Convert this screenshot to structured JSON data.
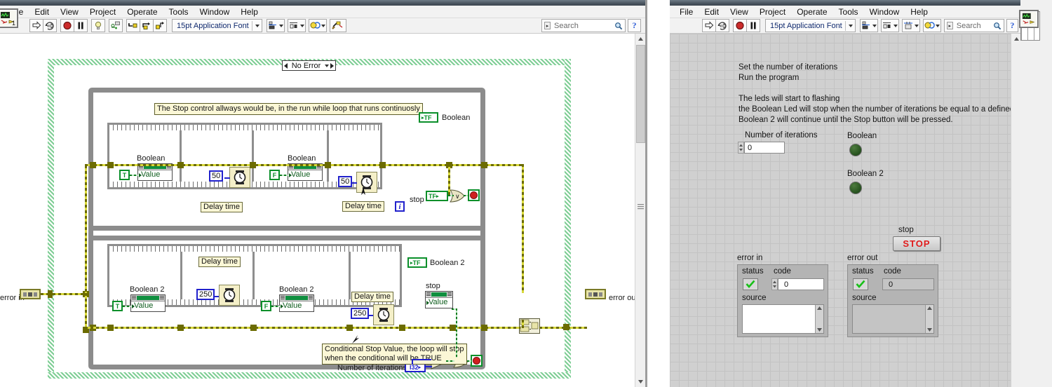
{
  "block_diagram_window": {
    "menu": [
      "File",
      "Edit",
      "View",
      "Project",
      "Operate",
      "Tools",
      "Window",
      "Help"
    ],
    "toolbar": {
      "run_icon": "run-arrow-icon",
      "run_continuously_icon": "run-continuously-icon",
      "abort_icon": "abort-execution-icon",
      "pause_icon": "pause-icon",
      "highlight_icon": "highlight-execution-bulb-icon",
      "retain_wire_icon": "retain-wire-values-icon",
      "step_into_icon": "step-into-icon",
      "step_over_icon": "step-over-icon",
      "step_out_icon": "step-out-icon",
      "font": "15pt Application Font",
      "align_icon": "align-objects-icon",
      "distribute_icon": "distribute-objects-icon",
      "reorder_icon": "reorder-objects-icon",
      "cleanup_icon": "clean-up-diagram-icon",
      "search_placeholder": "Search",
      "help_icon": "context-help-icon",
      "vi_icon_badge": "1"
    },
    "diagram": {
      "case_selector": "No Error",
      "comment_top": "The Stop control allways would be, in the run while loop that runs continuosly",
      "comment_bottom": "Conditional Stop Value, the loop will stop\nwhen the conditional will be TRUE",
      "loop1": {
        "frames": [
          {
            "bool_const": "T",
            "prop_label": "Boolean",
            "prop_row": "Value"
          },
          {
            "num_const": "50",
            "delay_label": "Delay time",
            "node": "wait-ms-icon"
          },
          {
            "bool_const": "F",
            "prop_label": "Boolean",
            "prop_row": "Value"
          },
          {
            "num_const": "50",
            "delay_label": "Delay time",
            "node": "wait-ms-icon"
          }
        ],
        "indicator_label": "Boolean",
        "indicator_text": "TF",
        "iteration_terminal": "i",
        "stop_label": "stop",
        "stop_terminal_text": "TF",
        "or_gate": "or-gate",
        "loop_stop": "loop-conditional-terminal"
      },
      "loop2": {
        "frames": [
          {
            "bool_const": "T",
            "prop_label": "Boolean 2",
            "prop_row": "Value"
          },
          {
            "num_const": "250",
            "delay_label": "Delay time",
            "node": "wait-ms-icon"
          },
          {
            "bool_const": "F",
            "prop_label": "Boolean 2",
            "prop_row": "Value"
          },
          {
            "num_const": "250",
            "delay_label": "Delay time",
            "node": "wait-ms-icon"
          }
        ],
        "indicator_label": "Boolean 2",
        "indicator_text": "TF",
        "stop_label": "stop",
        "stop_prop_row": "Value",
        "iteration_terminal": "i",
        "iterations_label": "Number of iterations",
        "iterations_type": "I32",
        "equal_gate": "=",
        "or_gate": "or-gate",
        "loop_stop": "loop-conditional-terminal"
      },
      "error_in_label": "error in",
      "error_out_label": "error out",
      "merge_errors": "merge-errors-node"
    }
  },
  "front_panel_window": {
    "menu": [
      "File",
      "Edit",
      "View",
      "Project",
      "Operate",
      "Tools",
      "Window",
      "Help"
    ],
    "toolbar": {
      "run_icon": "run-arrow-icon",
      "run_continuously_icon": "run-continuously-icon",
      "abort_icon": "abort-execution-icon",
      "pause_icon": "pause-icon",
      "font": "15pt Application Font",
      "align_icon": "align-objects-icon",
      "distribute_icon": "distribute-objects-icon",
      "resize_icon": "resize-objects-icon",
      "reorder_icon": "reorder-objects-icon",
      "search_placeholder": "Search",
      "help_icon": "context-help-icon"
    },
    "instructions": "Set the number of iterations\nRun the program\n\nThe leds will start to flashing\nthe Boolean Led will stop when the number of iterations be equal to a defined number.\nBoolean 2 will continue until the Stop button will be pressed.",
    "controls": {
      "iterations_label": "Number of iterations",
      "iterations_value": "0",
      "boolean_label": "Boolean",
      "boolean2_label": "Boolean 2",
      "stop_label": "stop",
      "stop_button": "STOP",
      "error_in": {
        "title": "error in",
        "status_label": "status",
        "code_label": "code",
        "code_value": "0",
        "source_label": "source",
        "source_value": "",
        "status_icon": "checkmark-icon"
      },
      "error_out": {
        "title": "error out",
        "status_label": "status",
        "code_label": "code",
        "code_value": "0",
        "source_label": "source",
        "source_value": "",
        "status_icon": "checkmark-icon"
      }
    }
  }
}
